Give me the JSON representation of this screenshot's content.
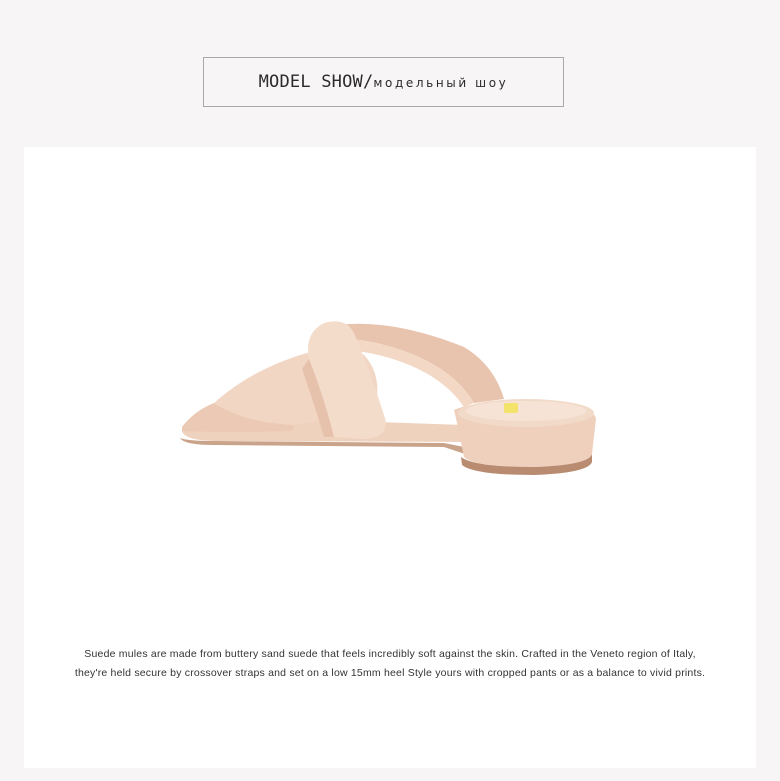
{
  "header": {
    "title_en": "MODEL SHOW/",
    "title_ru": "модельный шоу"
  },
  "product": {
    "image_alt_icon": "suede-mule-sandal-image",
    "colors": {
      "suede": "#f1d7c6",
      "suede_shadow": "#e2bda8",
      "sole": "#c9a38a",
      "insole": "#efcfb9",
      "logo": "#f3e36a"
    }
  },
  "description": {
    "line1": "Suede mules  are made from buttery sand suede that feels incredibly soft against the skin. Crafted in the Veneto region of Italy,",
    "line2": "they're held secure by crossover straps and set on a low 15mm heel Style yours with cropped pants or as a balance to vivid prints."
  }
}
